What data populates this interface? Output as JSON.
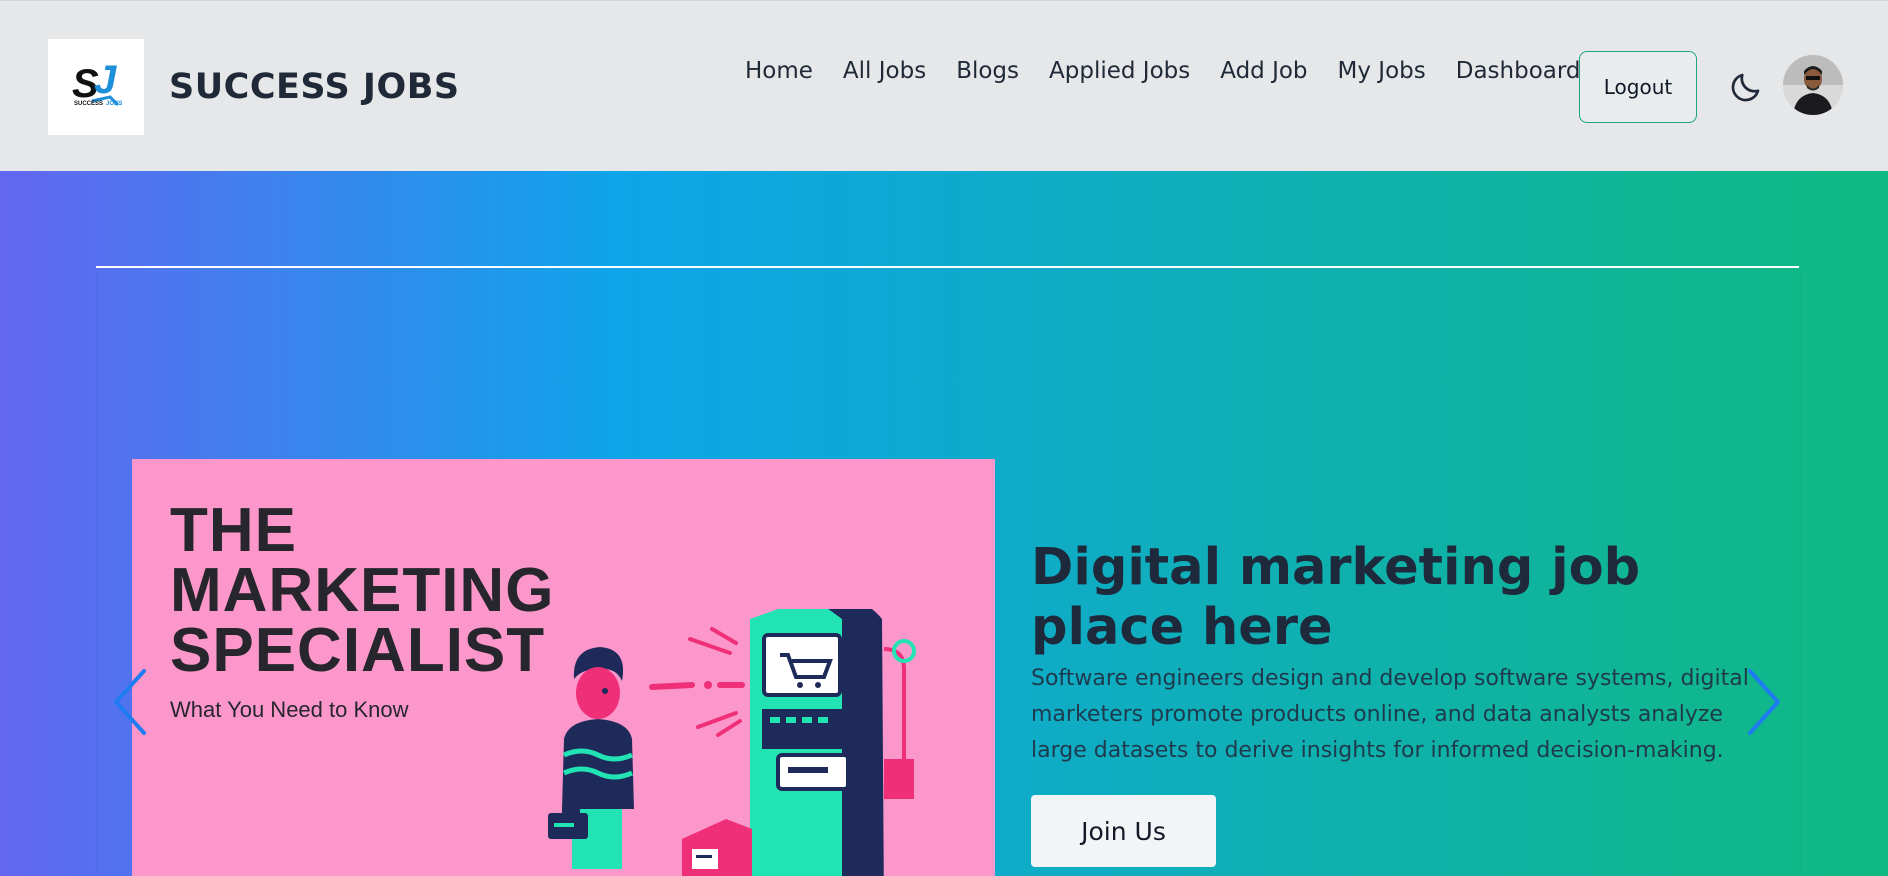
{
  "brand": {
    "logo_text": "SJ",
    "logo_caption_left": "SUCCESS",
    "logo_caption_right": "JOBS",
    "name": "SUCCESS JOBS"
  },
  "nav": {
    "links": [
      "Home",
      "All Jobs",
      "Blogs",
      "Applied Jobs",
      "Add Job",
      "My Jobs",
      "Dashboard"
    ],
    "logout_label": "Logout",
    "theme_icon": "moon-icon",
    "avatar_icon": "user-avatar"
  },
  "hero": {
    "gradient": [
      "#6366f1",
      "#0ea5e9",
      "#10b981"
    ],
    "slide": {
      "image_title_lines": [
        "THE",
        "MARKETING",
        "SPECIALIST"
      ],
      "image_subtitle": "What You Need to Know",
      "heading": "Digital marketing job place here",
      "description": "Software engineers design and develop software systems, digital marketers promote products online, and data analysts analyze large datasets to derive insights for informed decision-making.",
      "cta_label": "Join Us"
    },
    "prev_icon": "chevron-left-icon",
    "next_icon": "chevron-right-icon"
  },
  "colors": {
    "navbar_bg": "#e5e7e8",
    "accent_border": "#1fa57d",
    "arrow": "#1d7cf2",
    "slide_image_bg": "#fc97cb"
  }
}
